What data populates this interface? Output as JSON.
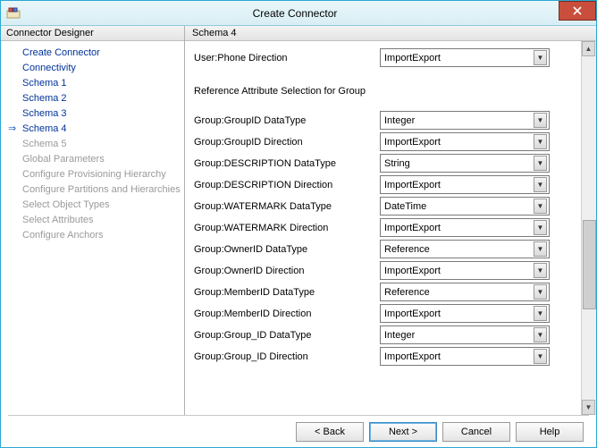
{
  "window": {
    "title": "Create Connector"
  },
  "nav": {
    "header": "Connector Designer",
    "items": [
      {
        "label": "Create Connector",
        "state": "link"
      },
      {
        "label": "Connectivity",
        "state": "link"
      },
      {
        "label": "Schema 1",
        "state": "link"
      },
      {
        "label": "Schema 2",
        "state": "link"
      },
      {
        "label": "Schema 3",
        "state": "link"
      },
      {
        "label": "Schema 4",
        "state": "active"
      },
      {
        "label": "Schema 5",
        "state": "disabled"
      },
      {
        "label": "Global Parameters",
        "state": "disabled"
      },
      {
        "label": "Configure Provisioning Hierarchy",
        "state": "disabled"
      },
      {
        "label": "Configure Partitions and Hierarchies",
        "state": "disabled"
      },
      {
        "label": "Select Object Types",
        "state": "disabled"
      },
      {
        "label": "Select Attributes",
        "state": "disabled"
      },
      {
        "label": "Configure Anchors",
        "state": "disabled"
      }
    ]
  },
  "main": {
    "header": "Schema 4",
    "top_row": {
      "label": "User:Phone Direction",
      "value": "ImportExport"
    },
    "section_header": "Reference Attribute Selection for Group",
    "rows": [
      {
        "label": "Group:GroupID DataType",
        "value": "Integer"
      },
      {
        "label": "Group:GroupID Direction",
        "value": "ImportExport"
      },
      {
        "label": "Group:DESCRIPTION DataType",
        "value": "String"
      },
      {
        "label": "Group:DESCRIPTION Direction",
        "value": "ImportExport"
      },
      {
        "label": "Group:WATERMARK DataType",
        "value": "DateTime"
      },
      {
        "label": "Group:WATERMARK Direction",
        "value": "ImportExport"
      },
      {
        "label": "Group:OwnerID DataType",
        "value": "Reference"
      },
      {
        "label": "Group:OwnerID Direction",
        "value": "ImportExport"
      },
      {
        "label": "Group:MemberID DataType",
        "value": "Reference"
      },
      {
        "label": "Group:MemberID Direction",
        "value": "ImportExport"
      },
      {
        "label": "Group:Group_ID DataType",
        "value": "Integer"
      },
      {
        "label": "Group:Group_ID Direction",
        "value": "ImportExport"
      }
    ]
  },
  "footer": {
    "back": "<  Back",
    "next": "Next  >",
    "cancel": "Cancel",
    "help": "Help"
  }
}
